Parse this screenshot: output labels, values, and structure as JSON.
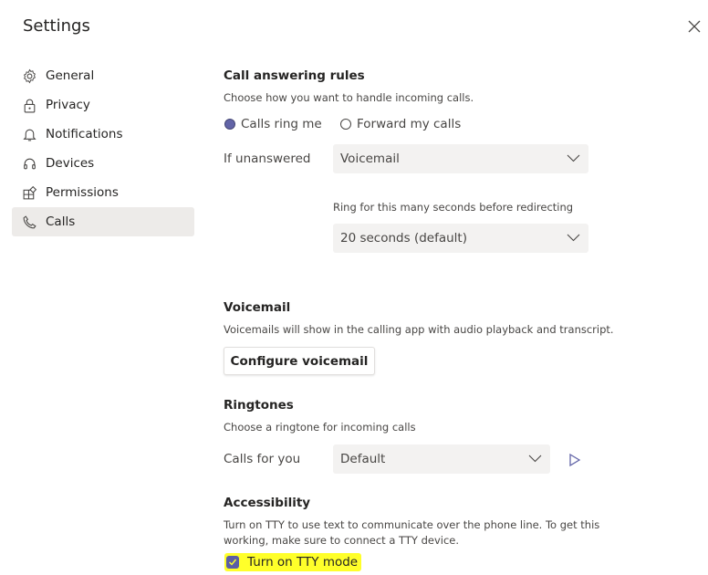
{
  "header": {
    "title": "Settings",
    "close_icon": "close-icon"
  },
  "sidebar": {
    "items": [
      {
        "label": "General",
        "icon": "gear-icon",
        "active": false
      },
      {
        "label": "Privacy",
        "icon": "lock-icon",
        "active": false
      },
      {
        "label": "Notifications",
        "icon": "bell-icon",
        "active": false
      },
      {
        "label": "Devices",
        "icon": "headset-icon",
        "active": false
      },
      {
        "label": "Permissions",
        "icon": "apps-icon",
        "active": false
      },
      {
        "label": "Calls",
        "icon": "phone-icon",
        "active": true
      }
    ]
  },
  "call_answering": {
    "heading": "Call answering rules",
    "description": "Choose how you want to handle incoming calls.",
    "options": [
      {
        "label": "Calls ring me",
        "selected": true
      },
      {
        "label": "Forward my calls",
        "selected": false
      }
    ],
    "if_unanswered_label": "If unanswered",
    "if_unanswered_value": "Voicemail",
    "ring_label": "Ring for this many seconds before redirecting",
    "ring_value": "20 seconds (default)"
  },
  "voicemail": {
    "heading": "Voicemail",
    "description": "Voicemails will show in the calling app with audio playback and transcript.",
    "button_label": "Configure voicemail"
  },
  "ringtones": {
    "heading": "Ringtones",
    "description": "Choose a ringtone for incoming calls",
    "calls_for_you_label": "Calls for you",
    "calls_for_you_value": "Default",
    "play_icon": "play-icon"
  },
  "accessibility": {
    "heading": "Accessibility",
    "description_line1": "Turn on TTY to use text to communicate over the phone line. To get this",
    "description_line2": "working, make sure to connect a TTY device.",
    "tty_label": "Turn on TTY mode",
    "tty_checked": true,
    "highlight_color": "#ffff2a"
  },
  "colors": {
    "accent": "#6264a7",
    "nav_active_bg": "#edebe9",
    "select_bg": "#f3f2f1"
  }
}
